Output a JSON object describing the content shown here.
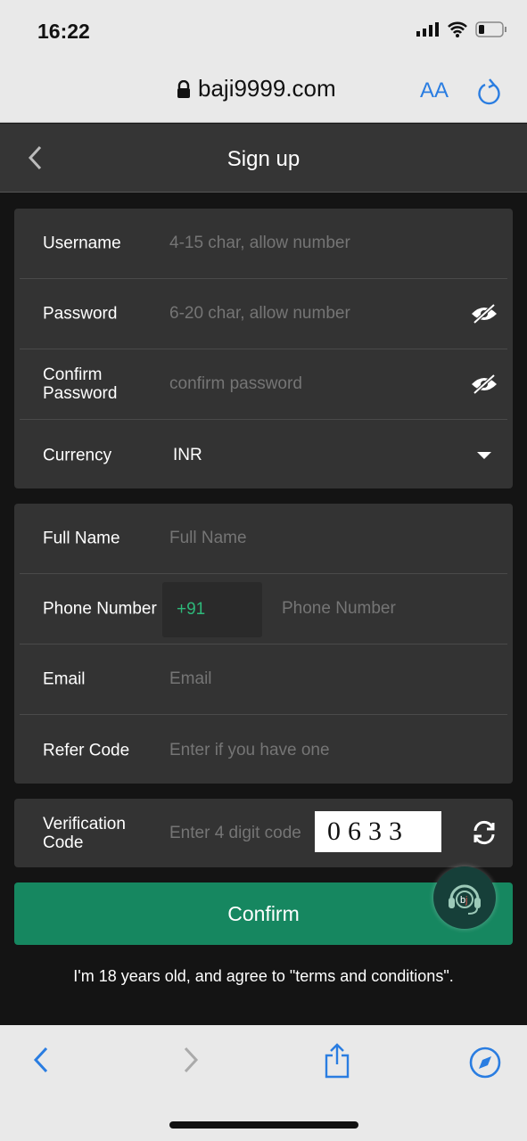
{
  "status_bar": {
    "time": "16:22"
  },
  "browser": {
    "url": "baji9999.com",
    "text_size_label": "AA"
  },
  "header": {
    "title": "Sign up"
  },
  "account_fields": [
    {
      "label": "Username",
      "placeholder": "4-15 char, allow number"
    },
    {
      "label": "Password",
      "placeholder": "6-20 char, allow number"
    },
    {
      "label": "Confirm Password",
      "placeholder": "confirm password"
    },
    {
      "label": "Currency",
      "value": "INR"
    }
  ],
  "personal_fields": [
    {
      "label": "Full Name",
      "placeholder": "Full Name"
    },
    {
      "label": "Phone Number",
      "prefix": "+91",
      "placeholder": "Phone Number"
    },
    {
      "label": "Email",
      "placeholder": "Email"
    },
    {
      "label": "Refer Code",
      "placeholder": "Enter if you have one"
    }
  ],
  "verification": {
    "label": "Verification Code",
    "placeholder": "Enter 4 digit code",
    "captcha": "0633"
  },
  "confirm_label": "Confirm",
  "terms": "I'm 18 years old, and agree to \"terms and conditions\".",
  "colors": {
    "accent": "#168760",
    "prefix": "#2eb87a",
    "browser_blue": "#2a7de1"
  }
}
